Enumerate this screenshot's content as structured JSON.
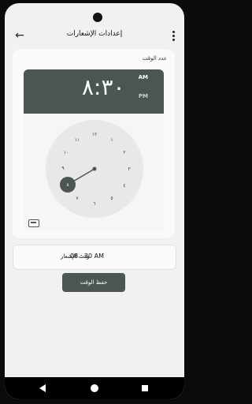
{
  "header": {
    "title": "إعدادات الإشعارات"
  },
  "time_picker": {
    "label": "عدد الوقت",
    "hour": "٨",
    "colon": ":",
    "minute": "٣٠",
    "am": "AM",
    "pm": "PM",
    "dial_numbers": [
      "١٢",
      "١",
      "٢",
      "٣",
      "٤",
      "٥",
      "٦",
      "٧",
      "٨",
      "٩",
      "١٠",
      "١١"
    ]
  },
  "notification": {
    "time_text": "08 : 30 AM",
    "label": "وقت الإشعار"
  },
  "save_button": {
    "label": "حفظ الوقت"
  },
  "icons": {
    "back": "arrow-left-icon",
    "menu": "more-vert-icon",
    "keyboard": "keyboard-icon",
    "nav_back": "nav-back-icon",
    "nav_home": "nav-home-icon",
    "nav_recent": "nav-recent-icon"
  },
  "colors": {
    "accent": "#4b5650"
  }
}
